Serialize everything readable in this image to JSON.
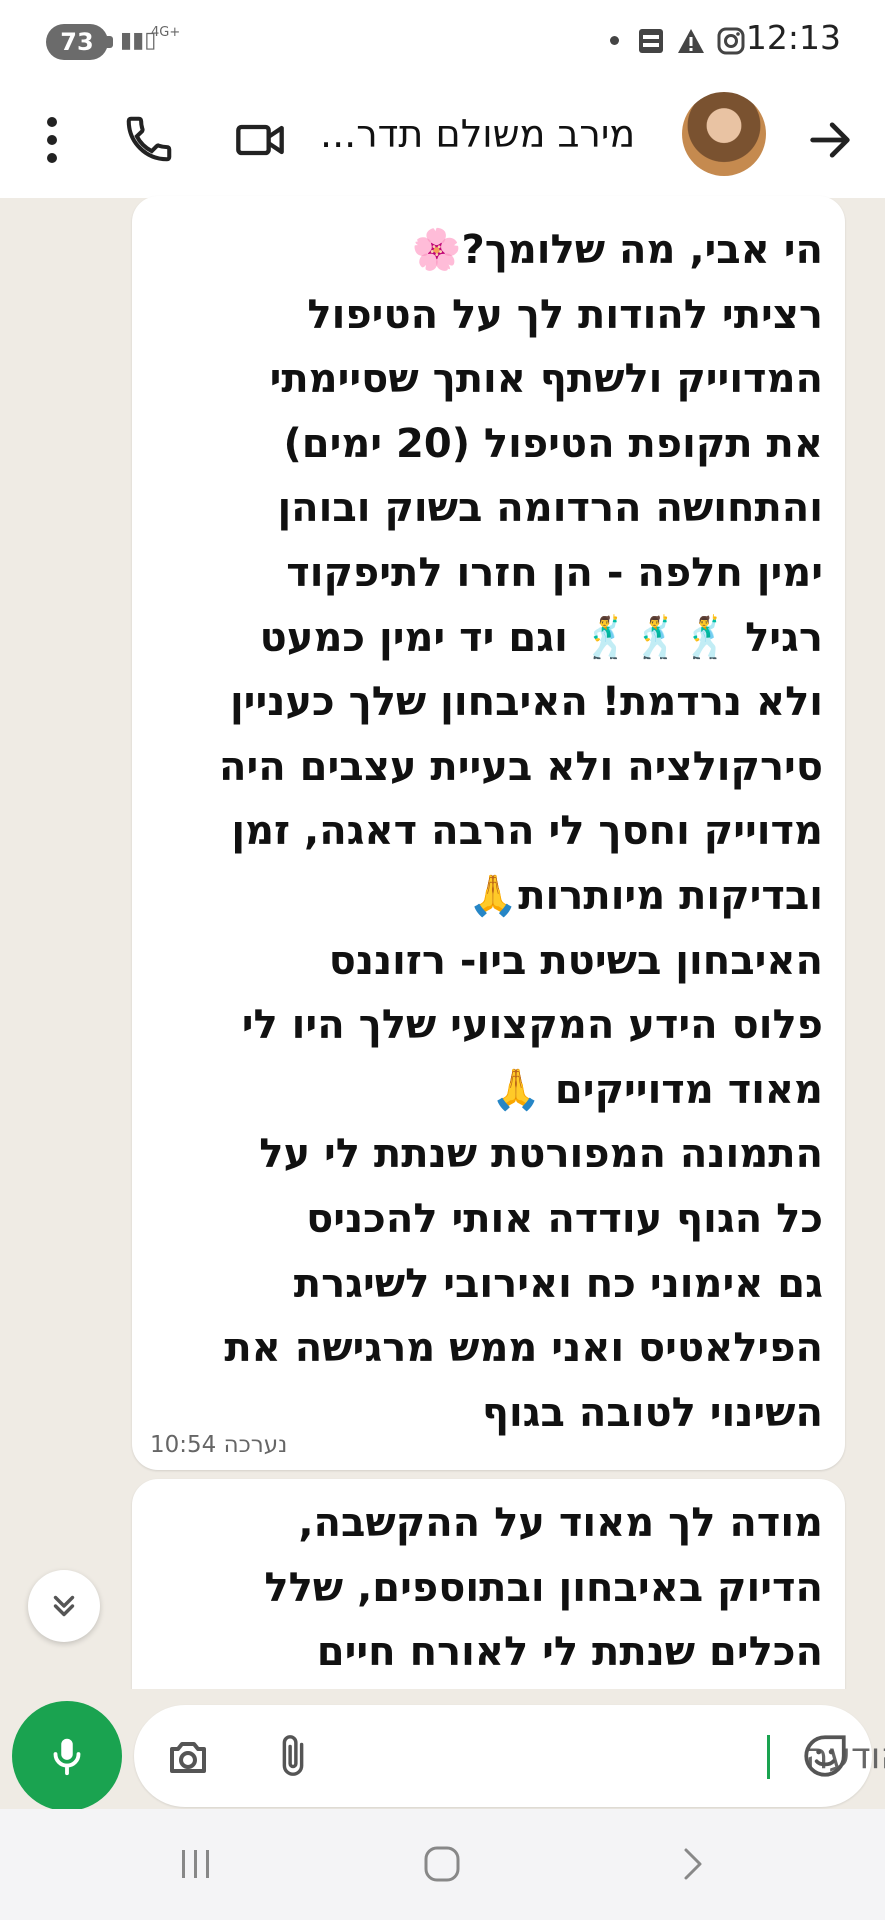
{
  "status_bar": {
    "battery": "73",
    "network": "4G+",
    "time": "12:13"
  },
  "header": {
    "contact_name": "מירב משולם תדר...",
    "icons": [
      "back-arrow-icon",
      "avatar",
      "video-call-icon",
      "phone-icon",
      "more-vert-icon"
    ]
  },
  "messages": [
    {
      "text": "הי אבי, מה שלומך?🌸\nרציתי להודות לך על הטיפול\nהמדוייק  ולשתף אותך שסיימתי\nאת תקופת הטיפול (20 ימים)\nוהתחושה הרדומה בשוק ובוהן\nימין חלפה - הן חזרו לתיפקוד\nרגיל 🕺🕺🕺 וגם יד ימין כמעט\nולא נרדמת! האיבחון שלך כעניין\nסירקולציה ולא בעיית עצבים היה\nמדוייק וחסך לי הרבה דאגה, זמן\nובדיקות מיותרות🙏\nהאיבחון בשיטת ביו- רזוננס\nפלוס הידע המקצועי שלך היו לי\nמאוד מדוייקים 🙏\nהתמונה המפורטת שנתת לי על\nכל הגוף עודדה אותי להכניס\nגם אימוני כח ואירובי לשיגרת\nהפילאטיס ואני ממש מרגישה את\nהשינוי לטובה בגוף",
      "status": "נערכה",
      "time": "10:54"
    },
    {
      "text": "מודה לך מאוד על ההקשבה,\nהדיוק באיבחון ובתוספים, שלל\nהכלים שנתת לי לאורח חיים"
    }
  ],
  "composer": {
    "placeholder": "הודעה",
    "icons": [
      "sticker-icon",
      "attach-icon",
      "camera-icon",
      "mic-icon"
    ]
  },
  "colors": {
    "chat_background": "#efebe4",
    "bubble": "#ffffff",
    "accent_green": "#1aa350"
  }
}
